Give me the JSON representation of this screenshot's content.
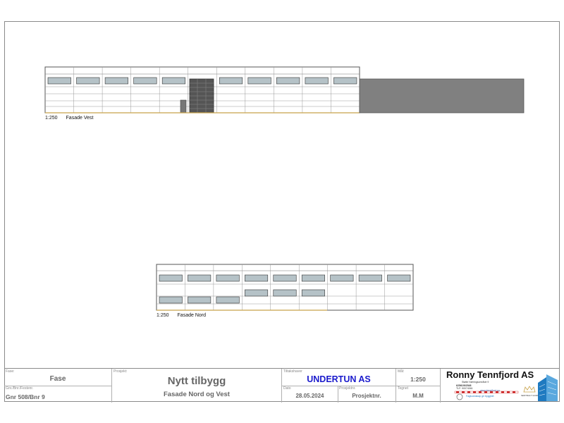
{
  "views": [
    {
      "scale": "1:250",
      "name": "Fasade Vest"
    },
    {
      "scale": "1:250",
      "name": "Fasade Nord"
    }
  ],
  "title_block": {
    "fase": {
      "label": "Fase:",
      "value": "Fase"
    },
    "gnr": {
      "label": "Gnr./Bnr./Festenr.",
      "value": "Gnr 508/Bnr 9"
    },
    "prosjekt": {
      "label": "Prosjekt:",
      "title": "Nytt tilbygg",
      "subtitle": "Fasade Nord og Vest"
    },
    "tiltakshaver": {
      "label": "Tiltakshaver",
      "value": "UNDERTUN AS"
    },
    "dato": {
      "label": "Dato",
      "value": "28.05.2024"
    },
    "prosjektnr": {
      "label": "Prosjektnr.",
      "value": "Prosjektnr."
    },
    "maal": {
      "label": "Mål:",
      "value": "1:250"
    },
    "tegnet": {
      "label": "Tegnet",
      "value": "M.M"
    }
  },
  "company": {
    "name": "Ronny Tennfjord AS",
    "address": "Støtte Næringsområde 9",
    "phone": "TLF: 90074061",
    "orgnr": "62561902548",
    "web": "www.rtennfjord.no",
    "tagline": "Fagkunnskap gir trygghet",
    "badge": "SENTRALT GODKJENT"
  },
  "colors": {
    "line": "#555555",
    "window_fill": "#b5c2c7",
    "gray_building": "#808080",
    "ground": "#c8a24a",
    "tiltakshaver_text": "#1a1acc",
    "logo_blue": "#1f7ac0"
  }
}
